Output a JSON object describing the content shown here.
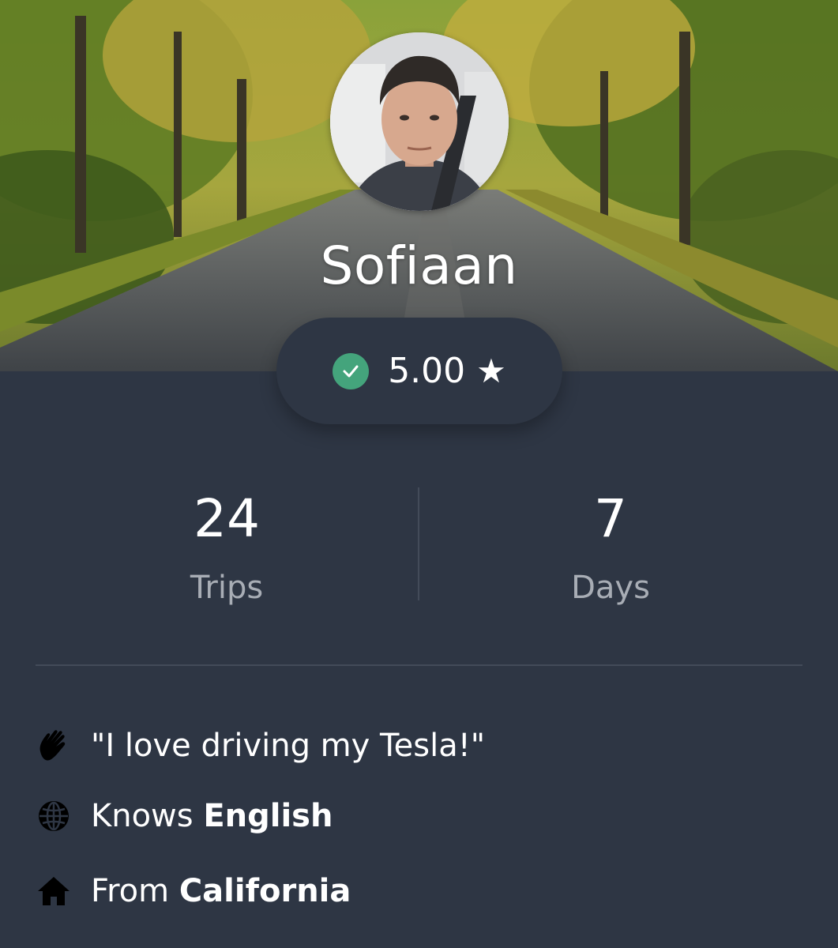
{
  "profile": {
    "name": "Sofiaan",
    "rating": "5.00",
    "star": "★"
  },
  "stats": [
    {
      "value": "24",
      "label": "Trips"
    },
    {
      "value": "7",
      "label": "Days"
    }
  ],
  "info": {
    "quote": "\"I love driving my Tesla!\"",
    "language_prefix": "Knows ",
    "language": "English",
    "origin_prefix": "From ",
    "origin": "California"
  },
  "icons": {
    "verified": "check-circle-icon",
    "rating": "star-icon",
    "quote": "waving-hand-icon",
    "language": "globe-icon",
    "origin": "home-icon"
  },
  "colors": {
    "background": "#2e3644",
    "verified_green": "#44a47c",
    "muted_text": "#a8adb5",
    "divider": "#434b59"
  }
}
